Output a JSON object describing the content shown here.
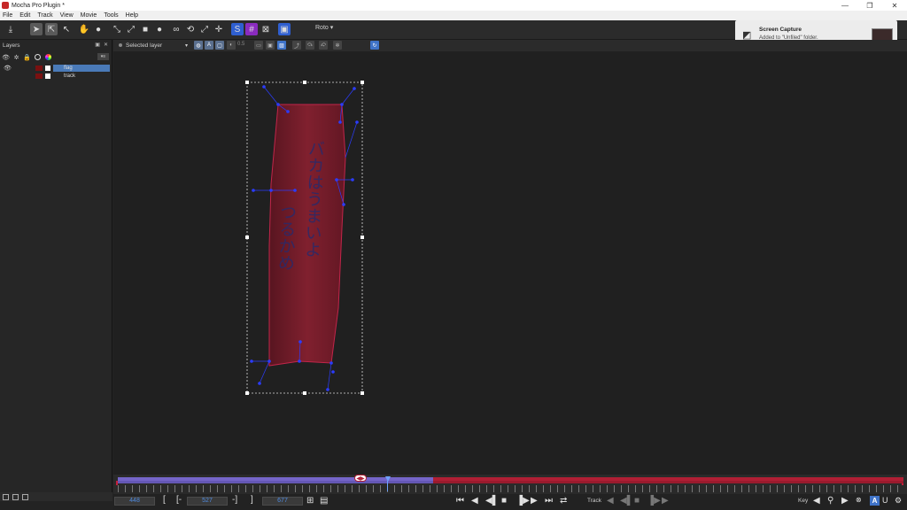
{
  "window": {
    "title": "Mocha Pro Plugin *",
    "minimize": "—",
    "restore": "❐",
    "close": "✕"
  },
  "menu": [
    "File",
    "Edit",
    "Track",
    "View",
    "Movie",
    "Tools",
    "Help"
  ],
  "toolbar": {
    "roto_dropdown": "Roto",
    "icons": [
      "save-icon",
      "select-icon",
      "select-point-icon",
      "add-point-icon",
      "pan-hand-icon",
      "zoom-icon",
      "spline-bezier-icon",
      "spline-xspline-icon",
      "rect-icon",
      "circle-icon",
      "link-icon",
      "transform-icon",
      "scale-icon",
      "move-icon",
      "surface-icon",
      "grid-icon",
      "align-icon",
      "fit-icon"
    ]
  },
  "toolbar2": {
    "selected_layer": "Selected layer",
    "opacity_value": "0.5"
  },
  "layers_panel": {
    "title": "Layers",
    "layers": [
      {
        "name": "flag",
        "selected": true,
        "color": "#7a1010"
      },
      {
        "name": "track",
        "selected": false,
        "color": "#7a1010"
      }
    ]
  },
  "notification": {
    "title": "Screen Capture",
    "body": "Added to \"Unfiled\" folder."
  },
  "viewer": {
    "text": [
      "バカはうまいよ",
      "つるかめ"
    ],
    "accent": "#2b3cff",
    "flag_color": "#7e1a28"
  },
  "timeline": {
    "in_frame": "448",
    "current_frame": "527",
    "out_frame": "677",
    "bracket_left": "[",
    "bracket_in": "[-",
    "bracket_out": "-]",
    "bracket_right": "]",
    "track_label": "Track",
    "key_label": "Key",
    "auto_label": "A",
    "purple": "#7565c9",
    "red": "#b01e34"
  }
}
